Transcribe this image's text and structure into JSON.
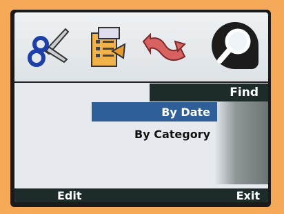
{
  "toolbar": {
    "icons": [
      {
        "name": "scissors-icon"
      },
      {
        "name": "notepad-icon"
      },
      {
        "name": "swap-arrow-icon"
      },
      {
        "name": "magnifier-icon",
        "selected": true
      }
    ]
  },
  "menu": {
    "header": "Find",
    "items": [
      {
        "label": "By Date",
        "selected": true
      },
      {
        "label": "By Category",
        "selected": false
      }
    ]
  },
  "softkeys": {
    "left": "Edit",
    "right": "Exit"
  },
  "colors": {
    "bezel": "#f7a95a",
    "header_bg": "#1d2b2b",
    "selection": "#2f5f99"
  }
}
